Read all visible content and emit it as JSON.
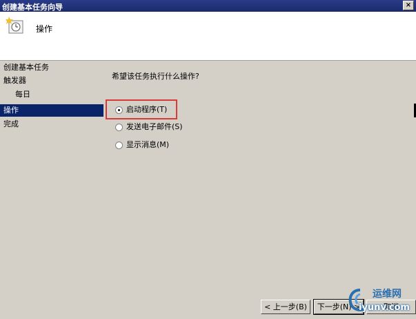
{
  "window": {
    "title": "创建基本任务向导",
    "close_glyph": "×"
  },
  "header": {
    "title": "操作",
    "icon": "clock-task-icon"
  },
  "sidebar": {
    "items": [
      {
        "label": "创建基本任务",
        "indent": false,
        "active": false
      },
      {
        "label": "触发器",
        "indent": false,
        "active": false
      },
      {
        "label": "每日",
        "indent": true,
        "active": false
      },
      {
        "label": "操作",
        "indent": false,
        "active": true
      },
      {
        "label": "完成",
        "indent": false,
        "active": false
      }
    ]
  },
  "main": {
    "question": "希望该任务执行什么操作?",
    "options": [
      {
        "label": "启动程序(T)",
        "checked": true
      },
      {
        "label": "发送电子邮件(S)",
        "checked": false
      },
      {
        "label": "显示消息(M)",
        "checked": false
      }
    ]
  },
  "footer": {
    "back_label": "< 上一步(B)",
    "next_label": "下一步(N) >",
    "cancel_label": "取消"
  },
  "watermark": {
    "line1": "运维网",
    "line2": "iyunv.com"
  },
  "colors": {
    "active_bg": "#0a246a",
    "highlight_border": "#d83a3a",
    "header_bg": "#ffffff",
    "dialog_bg": "#d4d0c8"
  }
}
